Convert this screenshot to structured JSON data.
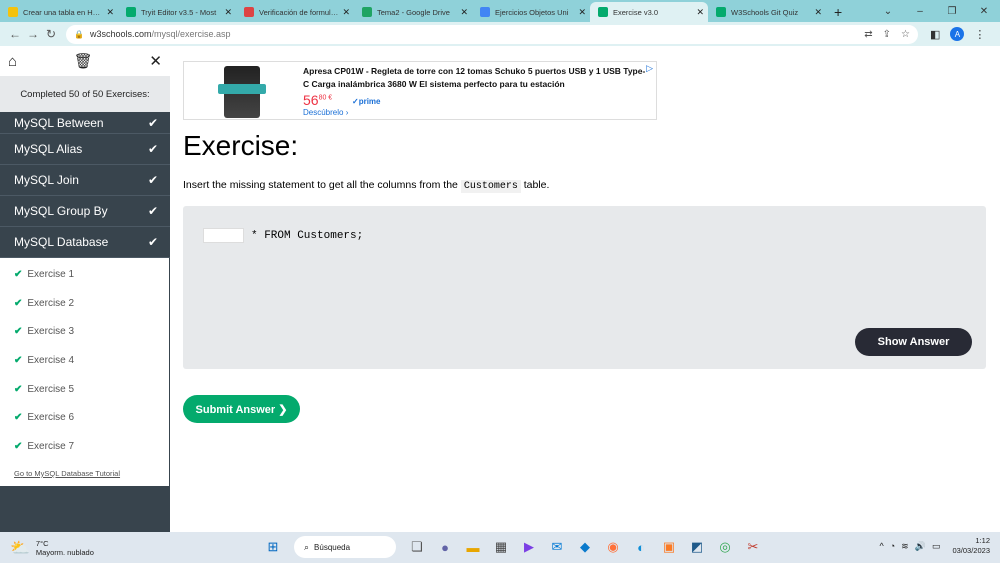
{
  "browser": {
    "tabs": [
      {
        "label": "Crear una tabla en HTML",
        "icon_color": "#f4c20d",
        "icon_name": "page-icon",
        "active": false
      },
      {
        "label": "Tryit Editor v3.5 - Most",
        "icon_color": "#04aa6d",
        "icon_name": "w3schools-icon",
        "active": false
      },
      {
        "label": "Verificación de formulario",
        "icon_color": "#d44",
        "icon_name": "um-icon",
        "active": false
      },
      {
        "label": "Tema2 - Google Drive",
        "icon_color": "#1fa463",
        "icon_name": "drive-icon",
        "active": false
      },
      {
        "label": "Ejercicios Objetos Uni",
        "icon_color": "#4285f4",
        "icon_name": "docs-icon",
        "active": false
      },
      {
        "label": "Exercise v3.0",
        "icon_color": "#04aa6d",
        "icon_name": "w3schools-icon",
        "active": true
      },
      {
        "label": "W3Schools Git Quiz",
        "icon_color": "#04aa6d",
        "icon_name": "w3schools-icon",
        "active": false
      }
    ],
    "new_tab": "+",
    "url_host": "w3schools.com",
    "url_path": "/mysql/exercise.asp",
    "profile_initial": "A"
  },
  "sidebar": {
    "progress": "Completed 50 of 50 Exercises:",
    "sections": [
      "MySQL Between",
      "MySQL Alias",
      "MySQL Join",
      "MySQL Group By",
      "MySQL Database"
    ],
    "exercises": [
      "Exercise 1",
      "Exercise 2",
      "Exercise 3",
      "Exercise 4",
      "Exercise 5",
      "Exercise 6",
      "Exercise 7"
    ],
    "tutorial_link": "Go to MySQL Database Tutorial"
  },
  "ad": {
    "title": "Apresa CP01W - Regleta de torre con 12 tomas Schuko 5 puertos USB y 1 USB Type-C Carga inalámbrica 3680 W El sistema perfecto para tu estación",
    "price_main": "56",
    "price_cents": "80 €",
    "prime": "✓prime",
    "link": "Descúbrelo ›"
  },
  "main": {
    "heading": "Exercise:",
    "instruction_before": "Insert the missing statement to get all the columns from the",
    "instruction_code": "Customers",
    "instruction_after": "table.",
    "code_rest": "* FROM Customers;",
    "show_answer": "Show Answer",
    "submit": "Submit Answer ❯"
  },
  "taskbar": {
    "temp": "7°C",
    "weather": "Mayorm. nublado",
    "search": "Búsqueda",
    "time": "1:12",
    "date": "03/03/2023"
  },
  "colors": {
    "accent_green": "#04aa6d",
    "sidebar_bg": "#38444d",
    "dark_button": "#282a35"
  }
}
